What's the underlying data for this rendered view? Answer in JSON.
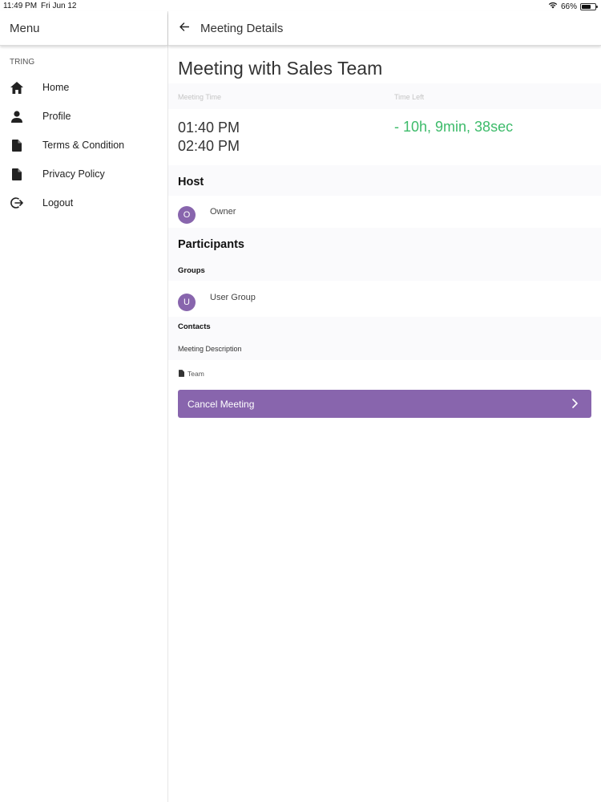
{
  "status_bar": {
    "time": "11:49 PM",
    "date": "Fri Jun 12",
    "battery": "66%",
    "battery_level": 0.66
  },
  "sidebar": {
    "title": "Menu",
    "section": "TRING",
    "items": [
      {
        "label": "Home",
        "icon": "home-icon"
      },
      {
        "label": "Profile",
        "icon": "person-icon"
      },
      {
        "label": "Terms & Condition",
        "icon": "document-icon"
      },
      {
        "label": "Privacy Policy",
        "icon": "document-icon"
      },
      {
        "label": "Logout",
        "icon": "logout-icon"
      }
    ]
  },
  "header": {
    "title": "Meeting Details",
    "back_icon": "arrow-left-icon"
  },
  "meeting": {
    "title": "Meeting with Sales Team",
    "time_label": "Meeting Time",
    "time_left_label": "Time Left",
    "start_time": "01:40 PM",
    "end_time": "02:40 PM",
    "time_left": "- 10h, 9min, 38sec",
    "time_left_color": "#3dbb6a"
  },
  "host": {
    "heading": "Host",
    "initial": "O",
    "name": "Owner"
  },
  "participants": {
    "heading": "Participants",
    "groups_label": "Groups",
    "group": {
      "initial": "U",
      "name": "User Group"
    },
    "contacts_label": "Contacts"
  },
  "description": {
    "label": "Meeting Description",
    "attachment": "Team",
    "attachment_icon": "file-icon"
  },
  "actions": {
    "cancel_label": "Cancel Meeting",
    "accent": "#8865ad"
  }
}
